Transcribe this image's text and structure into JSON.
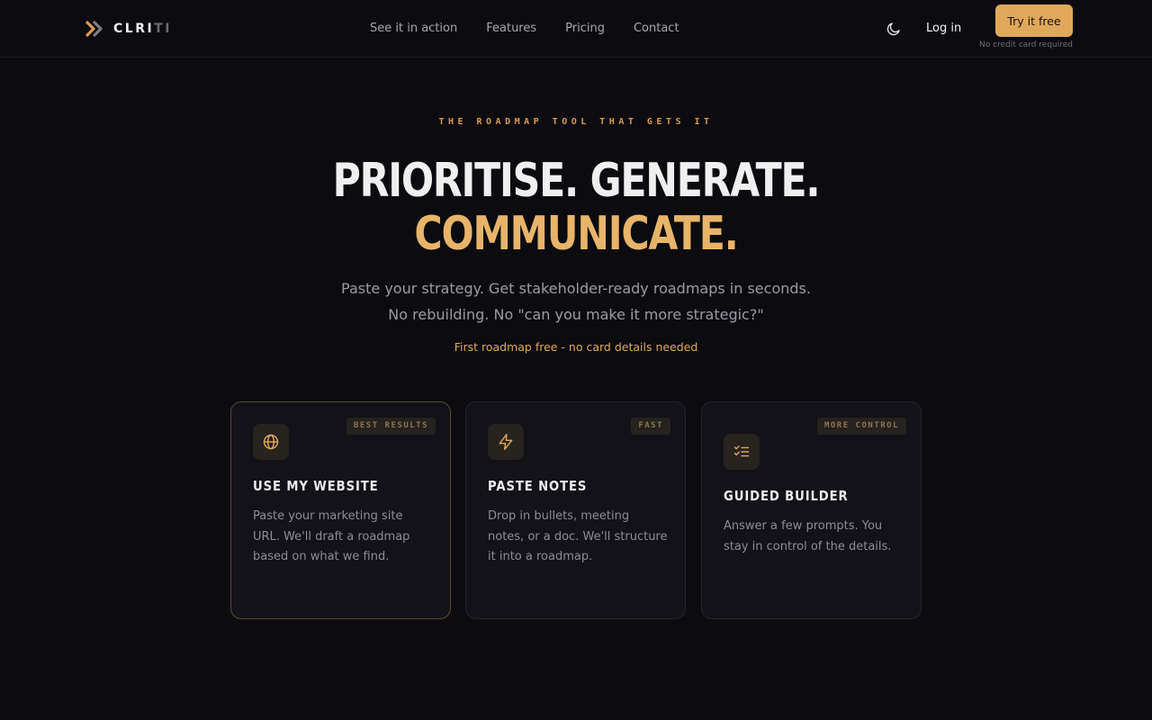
{
  "brand": {
    "name_bright": "CLRI",
    "name_dim": "TI"
  },
  "nav": {
    "links": [
      "See it in action",
      "Features",
      "Pricing",
      "Contact"
    ],
    "login_label": "Log in",
    "cta_label": "Try it free",
    "cta_note": "No credit card required",
    "theme_icon": "moon-icon"
  },
  "hero": {
    "eyebrow": "THE ROADMAP TOOL THAT GETS IT",
    "headline_line1": "PRIORITISE. GENERATE.",
    "headline_line2": "COMMUNICATE.",
    "subhead": "Paste your strategy. Get stakeholder-ready roadmaps in seconds. No rebuilding. No \"can you make it more strategic?\"",
    "free_note": "First roadmap free - no card details needed"
  },
  "cards": [
    {
      "badge": "BEST RESULTS",
      "icon": "globe-icon",
      "title": "USE MY WEBSITE",
      "desc": "Paste your marketing site URL. We'll draft a roadmap based on what we find."
    },
    {
      "badge": "FAST",
      "icon": "lightning-icon",
      "title": "PASTE NOTES",
      "desc": "Drop in bullets, meeting notes, or a doc. We'll structure it into a roadmap."
    },
    {
      "badge": "MORE CONTROL",
      "icon": "checklist-icon",
      "title": "GUIDED BUILDER",
      "desc": "Answer a few prompts. You stay in control of the details."
    }
  ],
  "colors": {
    "background": "#0c0c10",
    "accent": "#e0a85a",
    "card_bg": "#121218"
  }
}
